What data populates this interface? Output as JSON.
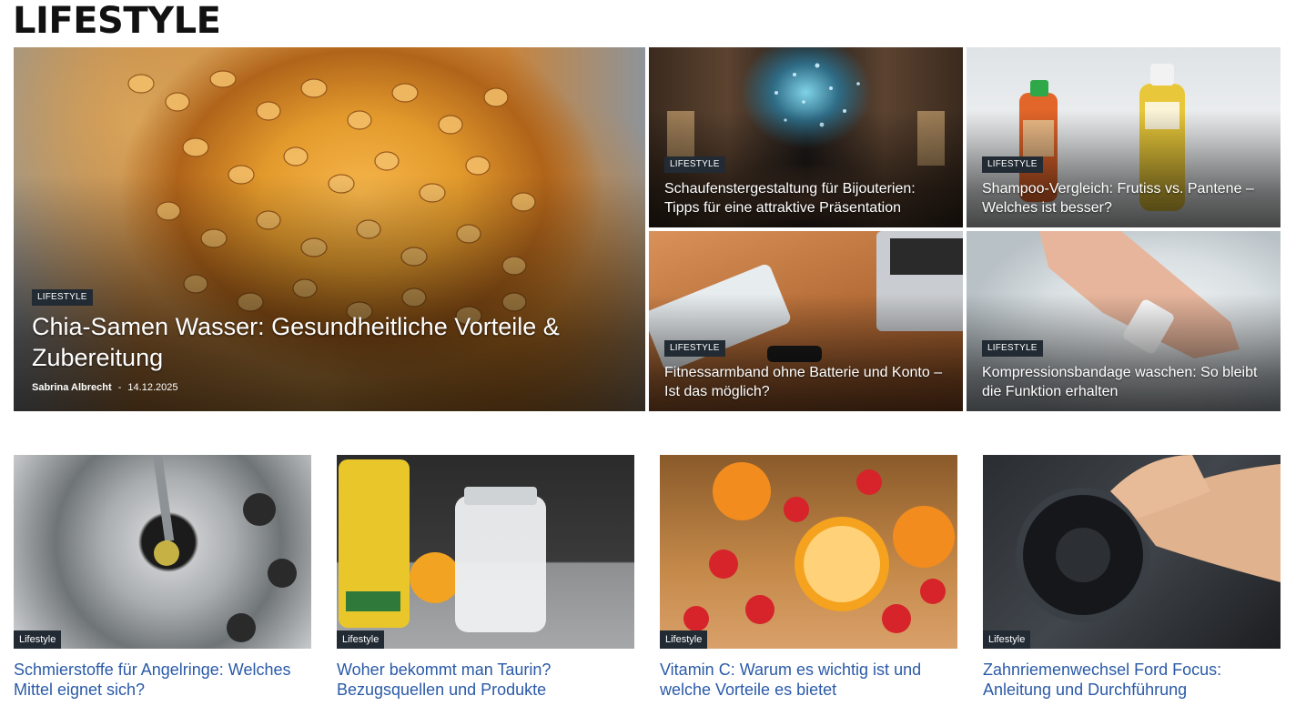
{
  "section": {
    "title": "LIFESTYLE"
  },
  "featured": [
    {
      "category": "LIFESTYLE",
      "title": "Chia-Samen Wasser: Gesundheitliche Vorteile & Zubereitung",
      "author": "Sabrina Albrecht",
      "separator": "-",
      "date": "14.12.2025",
      "image": "glass-with-soaked-seeds"
    },
    {
      "category": "LIFESTYLE",
      "title": "Schaufenstergestaltung für Bijouterien: Tipps für eine attraktive Präsentation",
      "image": "jewelry-shop-interior"
    },
    {
      "category": "LIFESTYLE",
      "title": "Shampoo-Vergleich: Frutiss vs. Pantene – Welches ist besser?",
      "image": "shampoo-bottles-in-foam"
    },
    {
      "category": "LIFESTYLE",
      "title": "Fitnessarmband ohne Batterie und Konto – Ist das möglich?",
      "image": "fitness-band-and-powerbank-on-desk"
    },
    {
      "category": "LIFESTYLE",
      "title": "Kompressionsbandage waschen: So bleibt die Funktion erhalten",
      "image": "hand-with-bandage-in-water"
    }
  ],
  "cards": [
    {
      "category": "Lifestyle",
      "title": "Schmierstoffe für Angelringe: Welches Mittel eignet sich?",
      "image": "reel-with-oil-drop"
    },
    {
      "category": "Lifestyle",
      "title": "Woher bekommt man Taurin? Bezugsquellen und Produkte",
      "image": "energy-can-and-jar"
    },
    {
      "category": "Lifestyle",
      "title": "Vitamin C: Warum es wichtig ist und welche Vorteile es bietet",
      "image": "oranges-and-strawberries"
    },
    {
      "category": "Lifestyle",
      "title": "Zahnriemenwechsel Ford Focus: Anleitung und Durchführung",
      "image": "hands-on-engine-belt"
    }
  ],
  "colors": {
    "badge_bg": "#222a33",
    "card_title": "#2a5aa8"
  }
}
